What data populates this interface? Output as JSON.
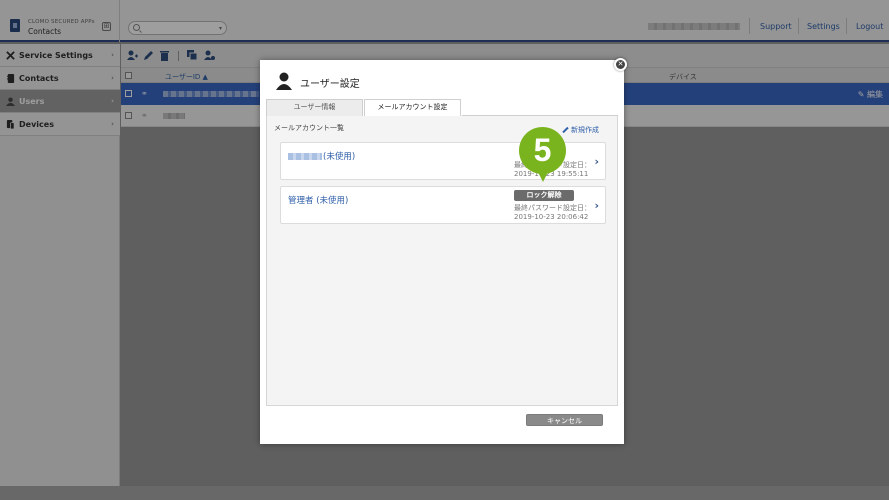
{
  "app": {
    "subtitle": "CLOMO SECURED APPs",
    "title": "Contacts"
  },
  "header": {
    "links": {
      "support": "Support",
      "settings": "Settings",
      "logout": "Logout"
    }
  },
  "sidebar": {
    "items": [
      {
        "label": "Service Settings",
        "icon": "tools-icon"
      },
      {
        "label": "Contacts",
        "icon": "contacts-book-icon"
      },
      {
        "label": "Users",
        "icon": "user-icon",
        "active": true
      },
      {
        "label": "Devices",
        "icon": "devices-icon"
      }
    ]
  },
  "table": {
    "headers": {
      "user_id": "ユーザーID ▲",
      "device": "デバイス"
    },
    "row_action": "編集"
  },
  "modal": {
    "title": "ユーザー設定",
    "tabs": [
      "ユーザー情報",
      "メールアカウント設定"
    ],
    "section_heading": "メールアカウント一覧",
    "new_link": "新規作成",
    "accounts": [
      {
        "name_suffix": "(未使用)",
        "meta_line1": "最終パスワード設定日：",
        "meta_line2": "2019-10-23 19:55:11"
      },
      {
        "name": "管理者 (未使用)",
        "lock_label": "ロック解除",
        "meta_line1": "最終パスワード設定日：",
        "meta_line2": "2019-10-23 20:06:42"
      }
    ],
    "cancel": "キャンセル"
  },
  "callout": {
    "step": "5",
    "color": "#79b41e"
  }
}
